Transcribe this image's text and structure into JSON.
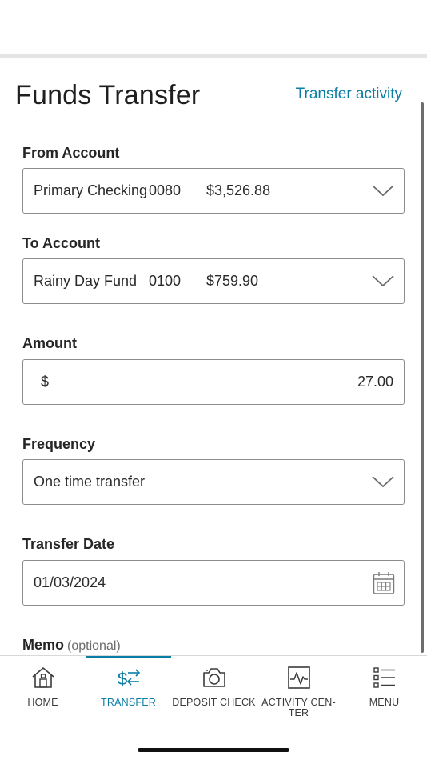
{
  "header": {
    "title": "Funds Transfer",
    "activity_link": "Transfer activity"
  },
  "form": {
    "from": {
      "label": "From Account",
      "account_name": "Primary Checking",
      "account_number": "0080",
      "balance": "$3,526.88"
    },
    "to": {
      "label": "To Account",
      "account_name": "Rainy Day Fund",
      "account_number": "0100",
      "balance": "$759.90"
    },
    "amount": {
      "label": "Amount",
      "currency": "$",
      "value": "27.00"
    },
    "frequency": {
      "label": "Frequency",
      "value": "One time transfer"
    },
    "transfer_date": {
      "label": "Transfer Date",
      "value": "01/03/2024"
    },
    "memo": {
      "label": "Memo",
      "hint": "(optional)"
    }
  },
  "tabs": [
    {
      "label": "HOME",
      "icon": "home-icon"
    },
    {
      "label": "TRANSFER",
      "icon": "transfer-icon",
      "active": true
    },
    {
      "label": "DEPOSIT CHECK",
      "icon": "camera-icon"
    },
    {
      "label": "ACTIVITY CEN-\nTER",
      "label_line1": "ACTIVITY CEN-",
      "label_line2": "TER",
      "icon": "activity-icon"
    },
    {
      "label": "MENU",
      "icon": "menu-icon"
    }
  ],
  "colors": {
    "accent": "#0a7ea4",
    "text": "#1f1f1f",
    "border": "#8c8c8c"
  }
}
